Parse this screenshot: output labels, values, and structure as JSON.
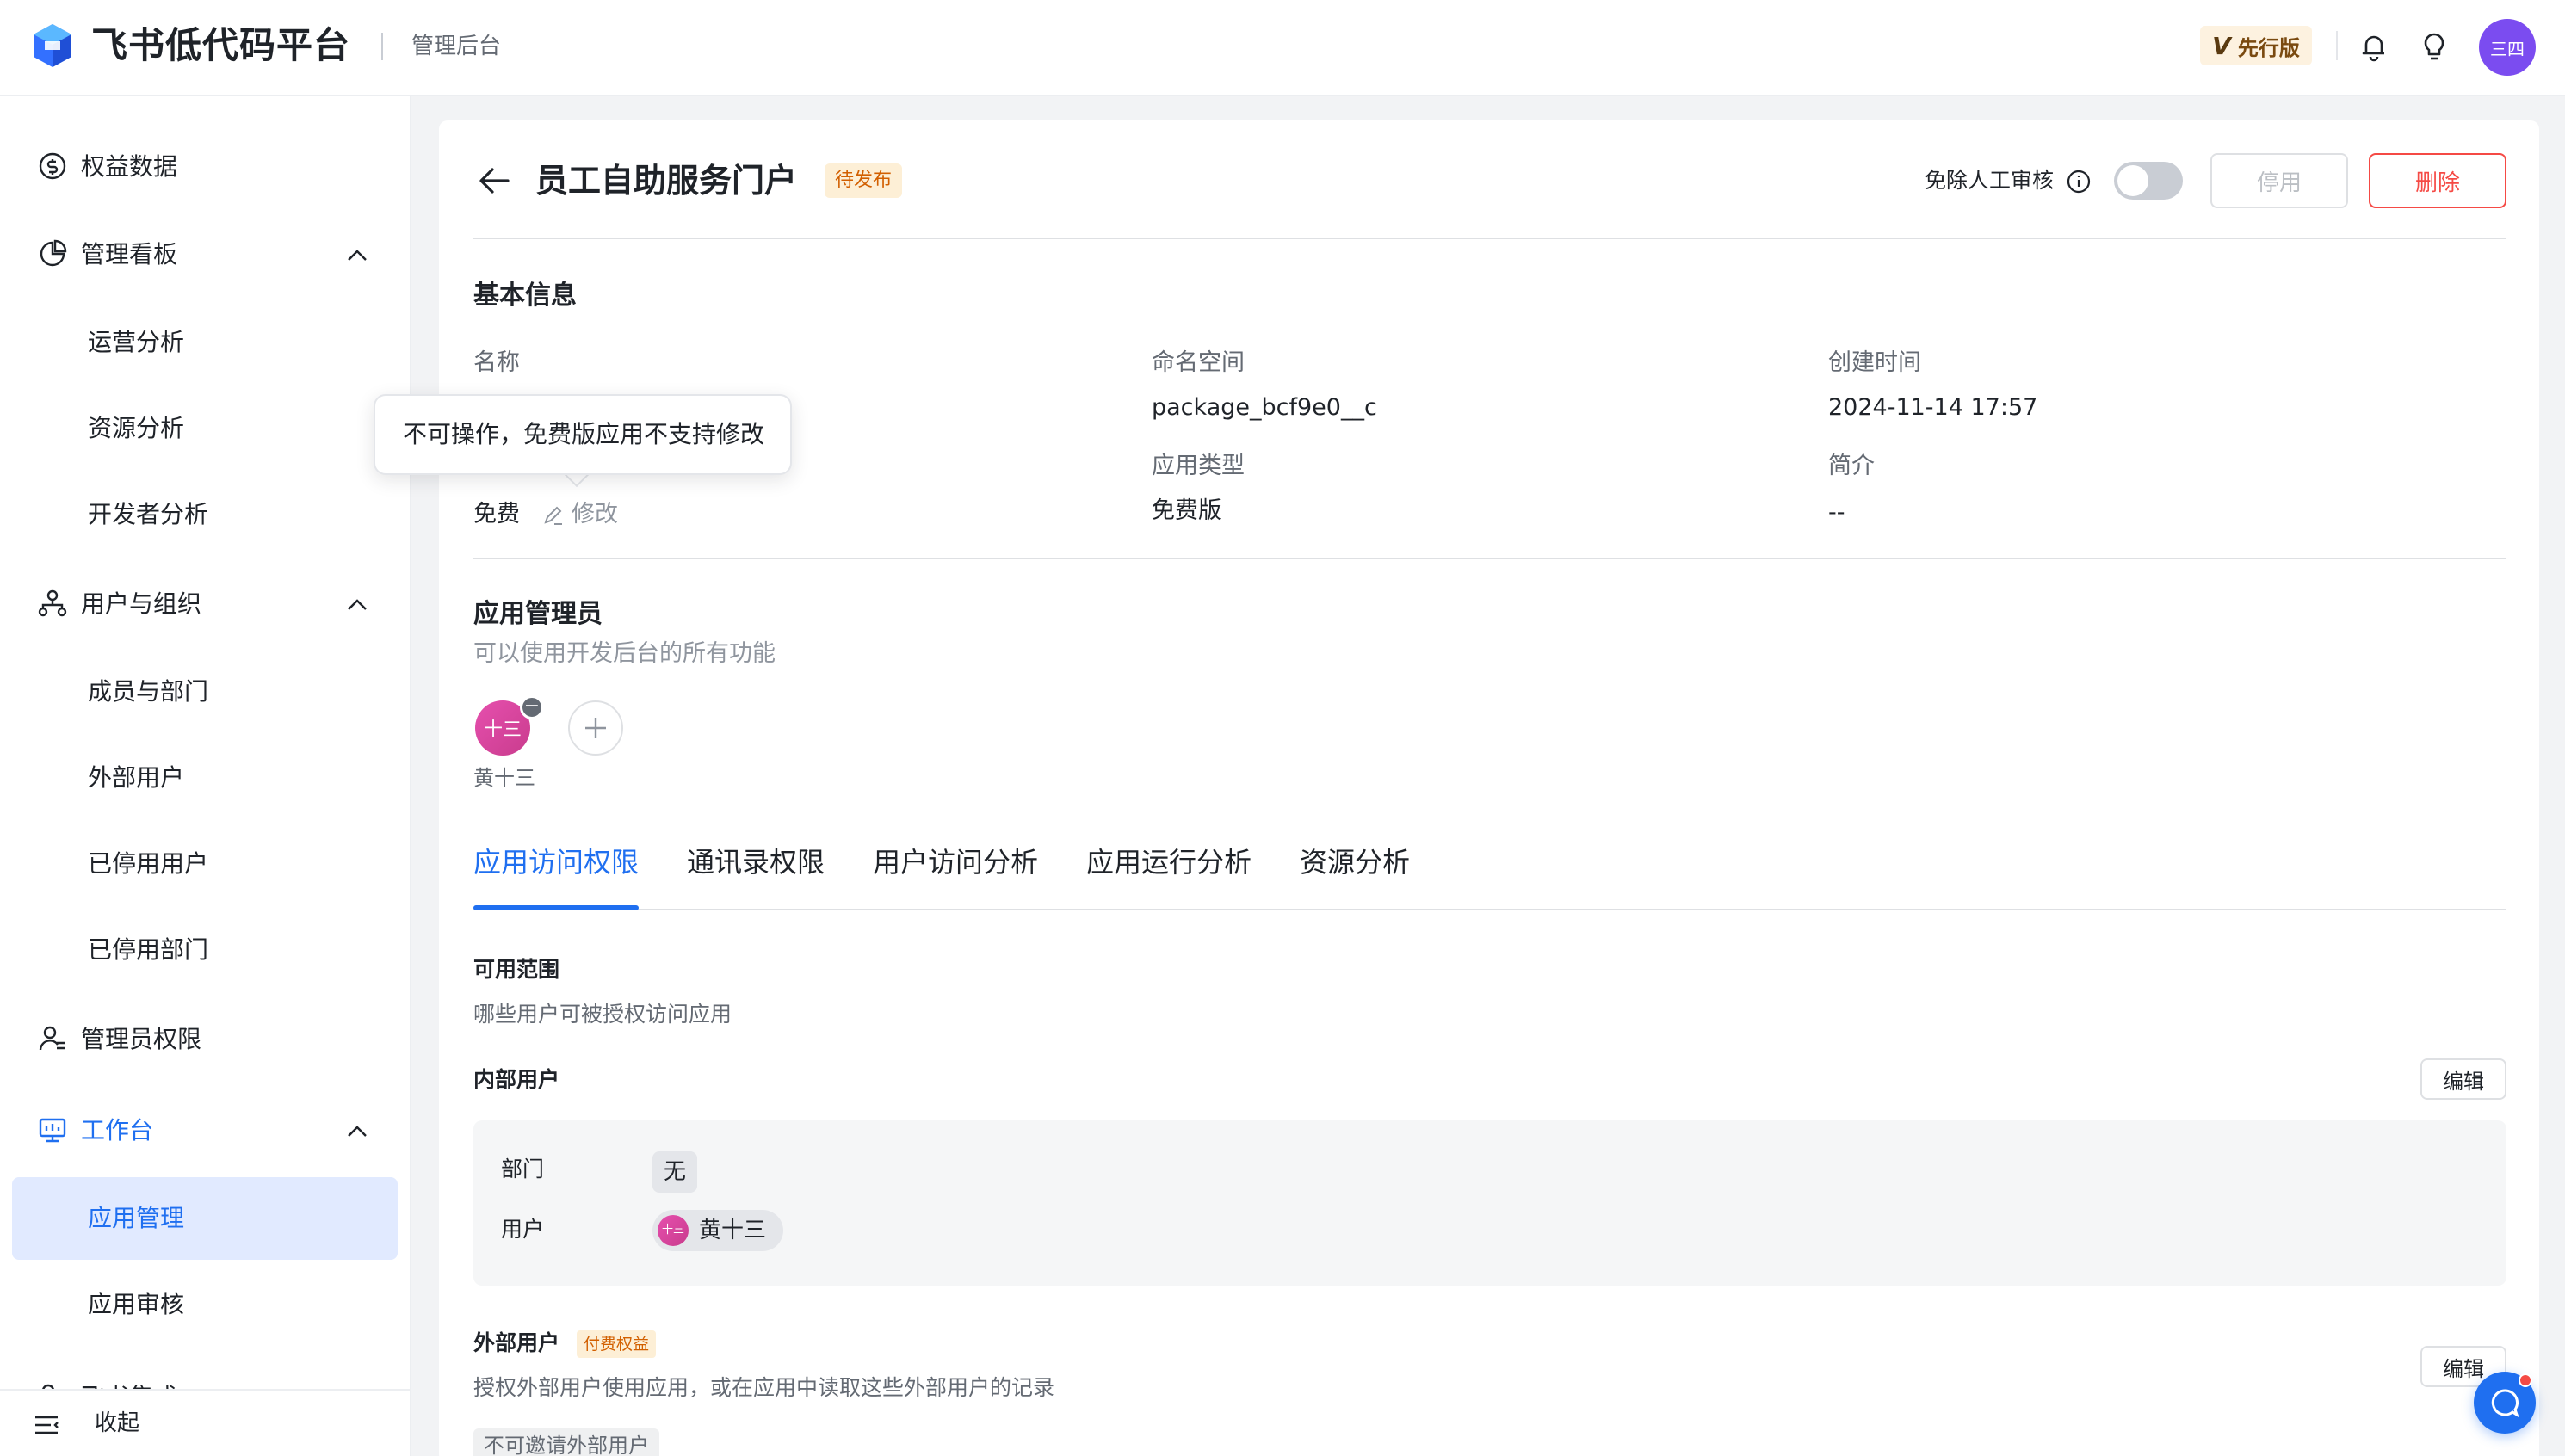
{
  "header": {
    "app_name": "飞书低代码平台",
    "subtitle": "管理后台",
    "plan_badge": {
      "icon": "V",
      "label": "先行版"
    },
    "icons": [
      "bell-icon",
      "lightbulb-icon"
    ],
    "avatar_text": "三四"
  },
  "sidebar": {
    "items": [
      {
        "label": "权益数据",
        "icon": "dollar-circle-icon"
      },
      {
        "label": "管理看板",
        "icon": "pie-chart-icon",
        "expanded": true
      },
      {
        "label": "运营分析"
      },
      {
        "label": "资源分析"
      },
      {
        "label": "开发者分析"
      },
      {
        "label": "用户与组织",
        "icon": "org-icon",
        "expanded": true
      },
      {
        "label": "成员与部门"
      },
      {
        "label": "外部用户"
      },
      {
        "label": "已停用用户"
      },
      {
        "label": "已停用部门"
      },
      {
        "label": "管理员权限",
        "icon": "admin-user-icon"
      },
      {
        "label": "工作台",
        "icon": "monitor-icon",
        "expanded": true
      },
      {
        "label": "应用管理",
        "selected": true
      },
      {
        "label": "应用审核"
      },
      {
        "label": "飞书集成"
      }
    ],
    "collapse_label": "收起"
  },
  "page": {
    "title": "员工自助服务门户",
    "status": "待发布",
    "exempt_review_label": "免除人工审核",
    "exempt_review_enabled": false,
    "disable_label": "停用",
    "delete_label": "删除"
  },
  "basic_info": {
    "title": "基本信息",
    "name_label": "名称",
    "namespace_label": "命名空间",
    "namespace_value": "package_bcf9e0__c",
    "created_label": "创建时间",
    "created_value": "2024-11-14 17:57",
    "plan_value": "免费",
    "edit_label": "修改",
    "app_type_label": "应用类型",
    "app_type_value": "免费版",
    "intro_label": "简介",
    "intro_value": "--",
    "tooltip": "不可操作，免费版应用不支持修改"
  },
  "admins": {
    "title": "应用管理员",
    "desc": "可以使用开发后台的所有功能",
    "list": [
      {
        "name": "黄十三",
        "avatar_text": "十三"
      }
    ]
  },
  "tabs": [
    "应用访问权限",
    "通讯录权限",
    "用户访问分析",
    "应用运行分析",
    "资源分析"
  ],
  "access": {
    "scope_title": "可用范围",
    "scope_desc": "哪些用户可被授权访问应用",
    "internal_title": "内部用户",
    "edit_label": "编辑",
    "dept_label": "部门",
    "dept_value": "无",
    "user_label": "用户",
    "user_value": "黄十三",
    "user_avatar_text": "十三",
    "external_title": "外部用户",
    "paid_tag": "付费权益",
    "external_desc": "授权外部用户使用应用，或在应用中读取这些外部用户的记录",
    "external_edit_label": "编辑",
    "invite_disabled": "不可邀请外部用户"
  },
  "colors": {
    "accent": "#1f6ff0",
    "danger": "#f54a45",
    "warning_tag": "#d25f00",
    "avatar_purple": "#7b4cf0",
    "avatar_pink": "#e64fae"
  }
}
